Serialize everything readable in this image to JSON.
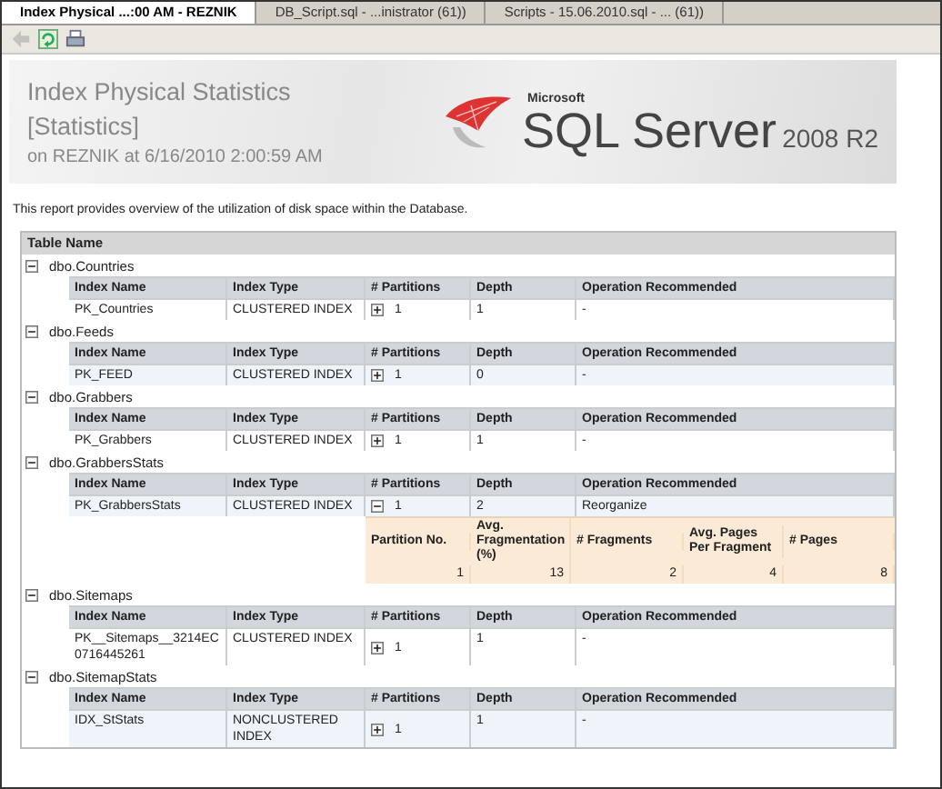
{
  "tabs": [
    {
      "label": "Index Physical ...:00 AM - REZNIK",
      "selected": true
    },
    {
      "label": "DB_Script.sql - ...inistrator (61))",
      "selected": false
    },
    {
      "label": "Scripts - 15.06.2010.sql - ... (61))",
      "selected": false
    }
  ],
  "toolbar": [
    {
      "kind": "back",
      "disabled": true
    },
    {
      "kind": "refresh",
      "disabled": false
    },
    {
      "kind": "print",
      "disabled": false
    }
  ],
  "report": {
    "title": "Index Physical Statistics",
    "subtitle": "[Statistics]",
    "server_line": "on REZNIK at 6/16/2010 2:00:59 AM",
    "logo": {
      "company": "Microsoft",
      "product": "SQL Server",
      "version": "2008 R2"
    },
    "description": "This report provides overview of the utilization of disk space within the Database."
  },
  "table": {
    "heading": "Table Name",
    "groups": [
      {
        "name": "dbo.Countries",
        "expanded": true,
        "columns": [
          "Index Name",
          "Index Type",
          "# Partitions",
          "Depth",
          "Operation Recommended"
        ],
        "indexes": [
          {
            "name": "PK_Countries",
            "type": "CLUSTERED INDEX",
            "expanded": false,
            "partitions": "1",
            "depth": "1",
            "operation": "-"
          }
        ]
      },
      {
        "name": "dbo.Feeds",
        "expanded": true,
        "columns": [
          "Index Name",
          "Index Type",
          "# Partitions",
          "Depth",
          "Operation Recommended"
        ],
        "indexes": [
          {
            "name": "PK_FEED",
            "type": "CLUSTERED INDEX",
            "expanded": false,
            "partitions": "1",
            "depth": "0",
            "operation": "-"
          }
        ]
      },
      {
        "name": "dbo.Grabbers",
        "expanded": true,
        "columns": [
          "Index Name",
          "Index Type",
          "# Partitions",
          "Depth",
          "Operation Recommended"
        ],
        "indexes": [
          {
            "name": "PK_Grabbers",
            "type": "CLUSTERED INDEX",
            "expanded": false,
            "partitions": "1",
            "depth": "1",
            "operation": "-"
          }
        ]
      },
      {
        "name": "dbo.GrabbersStats",
        "expanded": true,
        "columns": [
          "Index Name",
          "Index Type",
          "# Partitions",
          "Depth",
          "Operation Recommended"
        ],
        "indexes": [
          {
            "name": "PK_GrabbersStats",
            "type": "CLUSTERED INDEX",
            "expanded": true,
            "partitions": "1",
            "depth": "2",
            "operation": "Reorganize",
            "partition_columns": [
              "Partition No.",
              "Avg. Fragmentation (%)",
              "# Fragments",
              "Avg. Pages Per Fragment",
              "# Pages"
            ],
            "partition_rows": [
              [
                "1",
                "13",
                "2",
                "4",
                "8"
              ]
            ]
          }
        ]
      },
      {
        "name": "dbo.Sitemaps",
        "expanded": true,
        "columns": [
          "Index Name",
          "Index Type",
          "# Partitions",
          "Depth",
          "Operation Recommended"
        ],
        "indexes": [
          {
            "name": "PK__Sitemaps__3214EC0716445261",
            "type": "CLUSTERED INDEX",
            "expanded": false,
            "partitions": "1",
            "depth": "1",
            "operation": "-"
          }
        ]
      },
      {
        "name": "dbo.SitemapStats",
        "expanded": true,
        "columns": [
          "Index Name",
          "Index Type",
          "# Partitions",
          "Depth",
          "Operation Recommended"
        ],
        "indexes": [
          {
            "name": "IDX_StStats",
            "type": "NONCLUSTERED INDEX",
            "expanded": false,
            "partitions": "1",
            "depth": "1",
            "operation": "-"
          }
        ]
      }
    ]
  }
}
